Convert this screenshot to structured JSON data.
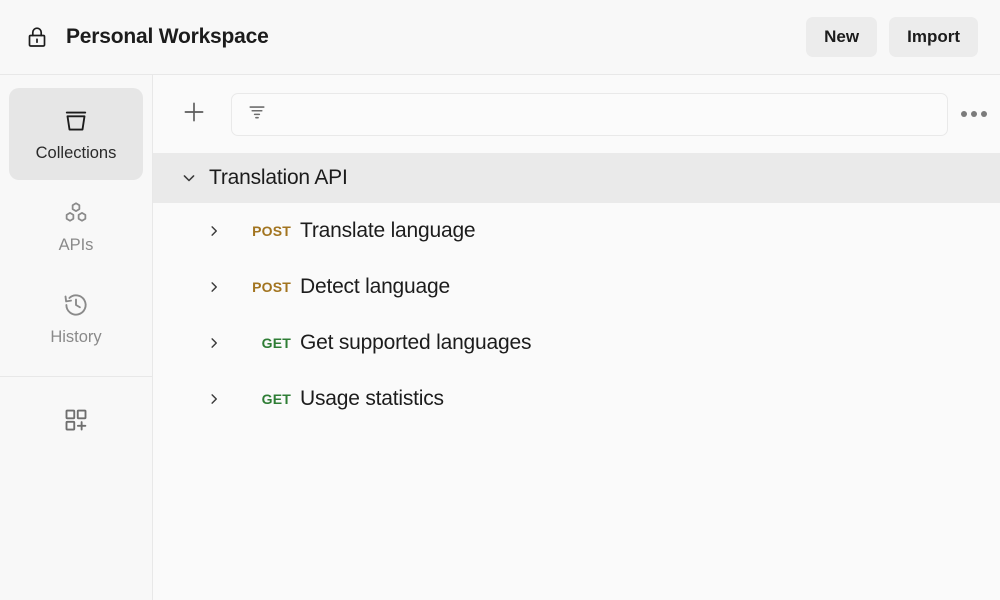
{
  "header": {
    "workspace_icon": "lock-icon",
    "title": "Personal Workspace",
    "new_label": "New",
    "import_label": "Import"
  },
  "sidebar": {
    "items": [
      {
        "label": "Collections",
        "icon": "collection-icon",
        "active": true
      },
      {
        "label": "APIs",
        "icon": "hexagons-icon",
        "active": false
      },
      {
        "label": "History",
        "icon": "clock-history-icon",
        "active": false
      }
    ],
    "bottom_action": {
      "icon": "grid-plus-icon",
      "label": ""
    }
  },
  "toolbar": {
    "add_icon": "plus-icon",
    "filter_icon": "filter-icon",
    "filter_value": "",
    "filter_placeholder": "",
    "more_icon": "more-horizontal-icon"
  },
  "tree": {
    "collection": {
      "name": "Translation API",
      "expanded": true,
      "caret_icon": "chevron-down-icon"
    },
    "requests": [
      {
        "method": "POST",
        "name": "Translate language",
        "caret_icon": "chevron-right-icon",
        "method_color": "#a2741f"
      },
      {
        "method": "POST",
        "name": "Detect language",
        "caret_icon": "chevron-right-icon",
        "method_color": "#a2741f"
      },
      {
        "method": "GET",
        "name": "Get supported languages",
        "caret_icon": "chevron-right-icon",
        "method_color": "#2e7d35"
      },
      {
        "method": "GET",
        "name": "Usage statistics",
        "caret_icon": "chevron-right-icon",
        "method_color": "#2e7d35"
      }
    ]
  },
  "colors": {
    "post": "#a2741f",
    "get": "#2e7d35",
    "selected_row": "#eaeaea",
    "panel_bg": "#fafafa",
    "chrome_bg": "#f8f8f8",
    "border": "#e8e8e8"
  }
}
